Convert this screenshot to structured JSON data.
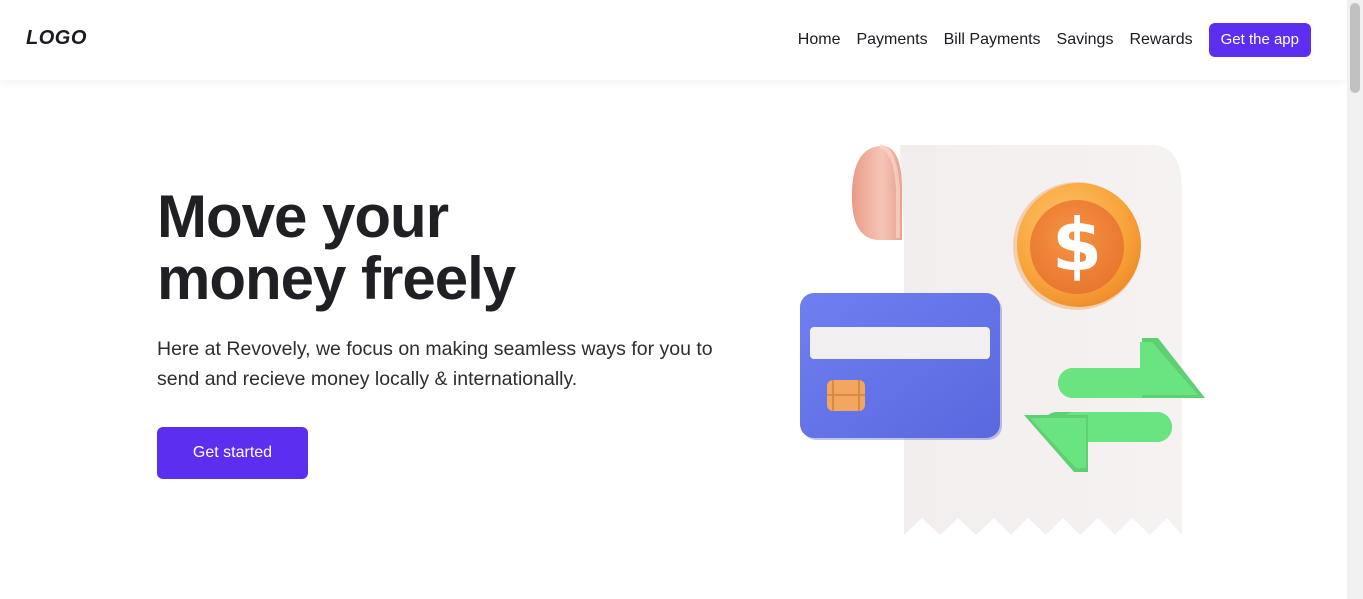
{
  "header": {
    "logo": "LOGO",
    "nav": {
      "home": "Home",
      "payments": "Payments",
      "bill_payments": "Bill Payments",
      "savings": "Savings",
      "rewards": "Rewards",
      "get_app": "Get the app"
    }
  },
  "hero": {
    "title_line1": "Move your",
    "title_line2": "money freely",
    "description": "Here at Revovely, we focus on making seamless ways for you to send and recieve money locally & internationally.",
    "cta": "Get started"
  },
  "colors": {
    "accent": "#5c2ef0",
    "card": "#6272e6",
    "arrows": "#67e07f",
    "coin": "#f6a03a"
  }
}
